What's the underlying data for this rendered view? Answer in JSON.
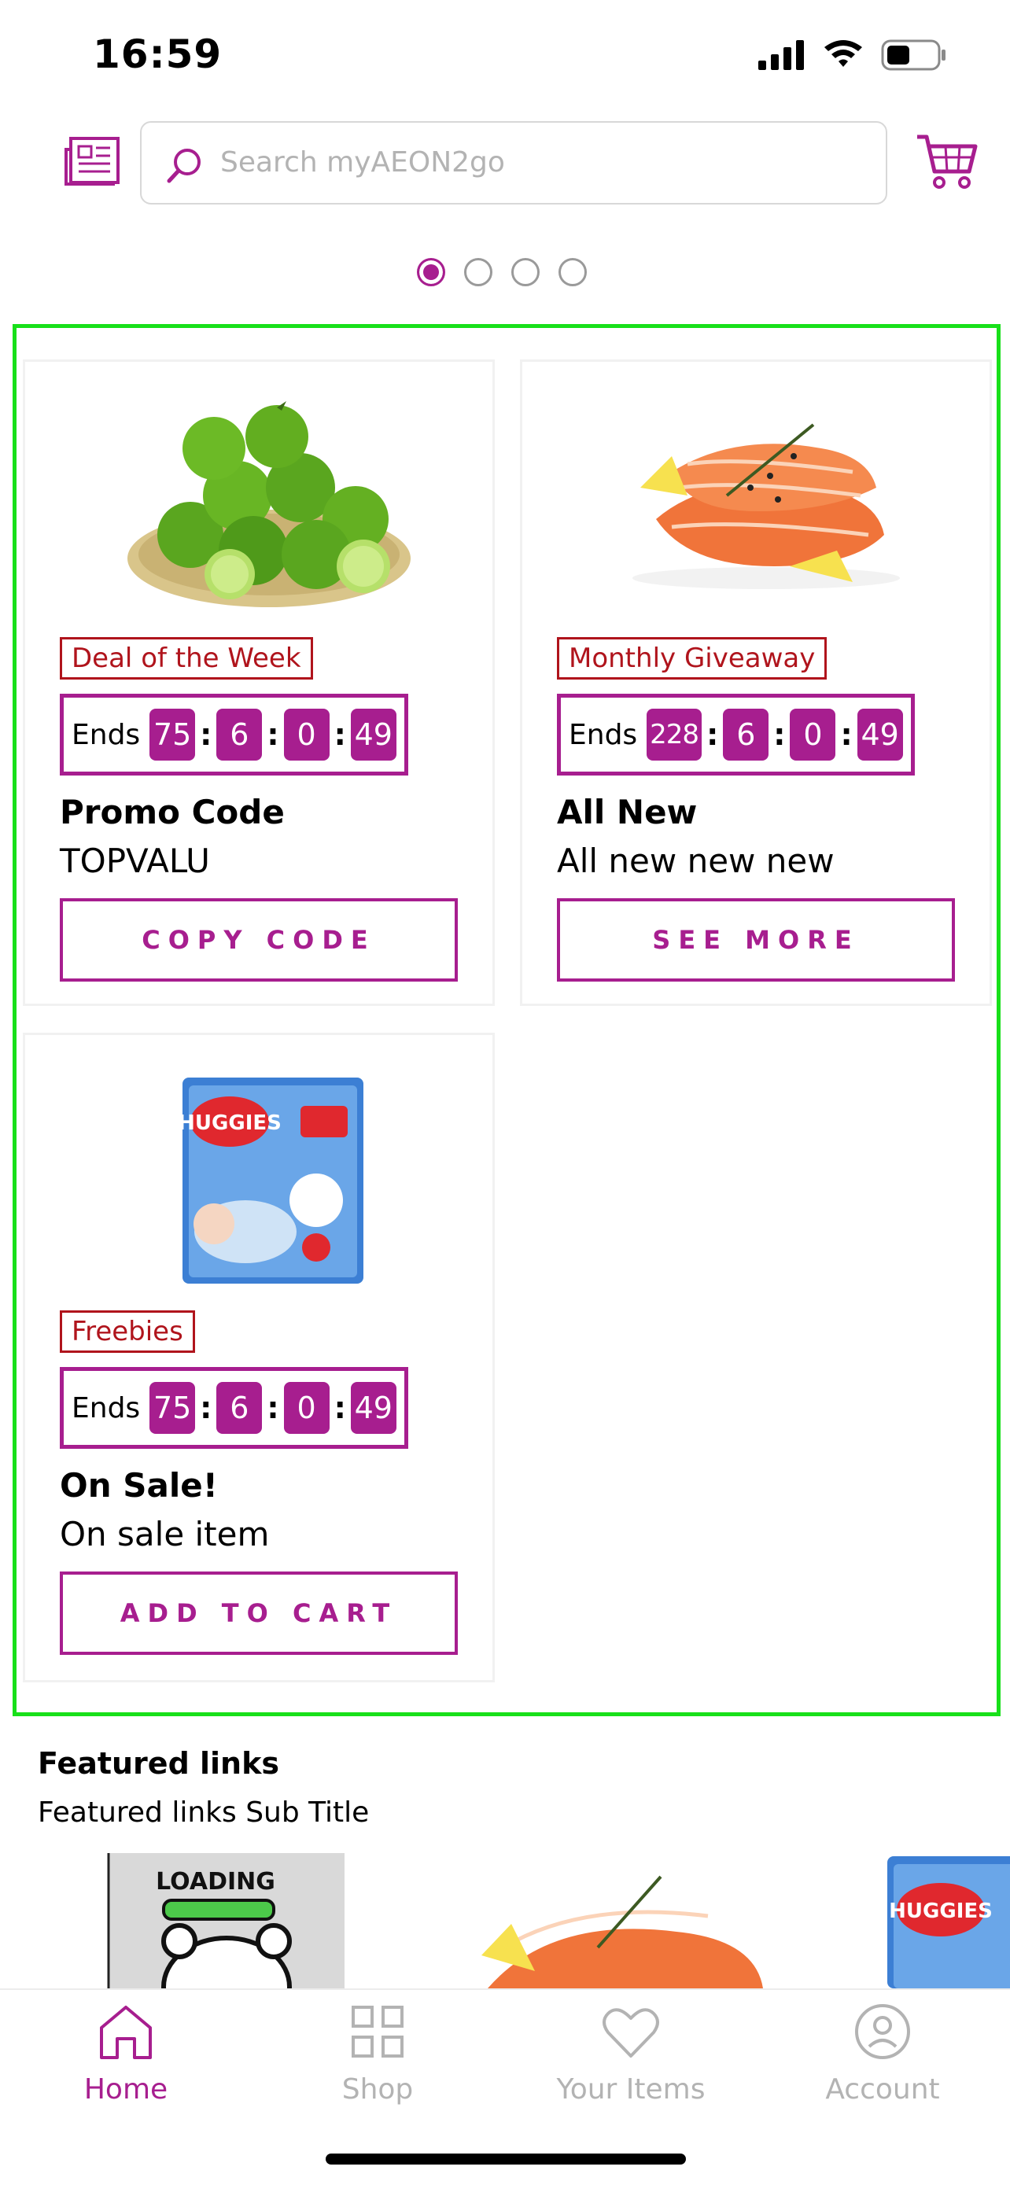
{
  "status_bar": {
    "time": "16:59",
    "icons": [
      "signal-icon",
      "wifi-icon",
      "battery-icon"
    ]
  },
  "header": {
    "menu_icon": "list-icon",
    "search_placeholder": "Search myAEON2go",
    "cart_icon": "cart-icon"
  },
  "carousel": {
    "page_count": 4,
    "active_index": 0
  },
  "promotions": [
    {
      "image": "limes-in-basket",
      "tag": "Deal of the Week",
      "timer": {
        "label": "Ends",
        "days": "75",
        "hours": "6",
        "minutes": "0",
        "seconds": "49"
      },
      "title": "Promo Code",
      "subtitle": "TOPVALU",
      "button": "COPY CODE"
    },
    {
      "image": "salmon-fillet",
      "tag": "Monthly Giveaway",
      "timer": {
        "label": "Ends",
        "days": "228",
        "hours": "6",
        "minutes": "0",
        "seconds": "49"
      },
      "title": "All New",
      "subtitle": "All new new new",
      "button": "SEE MORE"
    },
    {
      "image": "huggies-diaper-pack",
      "tag": "Freebies",
      "timer": {
        "label": "Ends",
        "days": "75",
        "hours": "6",
        "minutes": "0",
        "seconds": "49"
      },
      "title": "On Sale!",
      "subtitle": "On sale item",
      "button": "ADD TO CART"
    }
  ],
  "featured": {
    "title": "Featured links",
    "subtitle": "Featured links Sub Title",
    "loading_text": "LOADING",
    "huggies_text": "HUGGIES"
  },
  "tab_bar": {
    "tabs": [
      {
        "label": "Home",
        "icon": "home-icon",
        "active": true
      },
      {
        "label": "Shop",
        "icon": "grid-icon",
        "active": false
      },
      {
        "label": "Your Items",
        "icon": "heart-icon",
        "active": false
      },
      {
        "label": "Account",
        "icon": "user-icon",
        "active": false
      }
    ]
  },
  "colors": {
    "brand": "#a71e8f",
    "tag_red": "#b0141c",
    "highlight_green": "#18e01a",
    "inactive_gray": "#b3b3b3"
  }
}
